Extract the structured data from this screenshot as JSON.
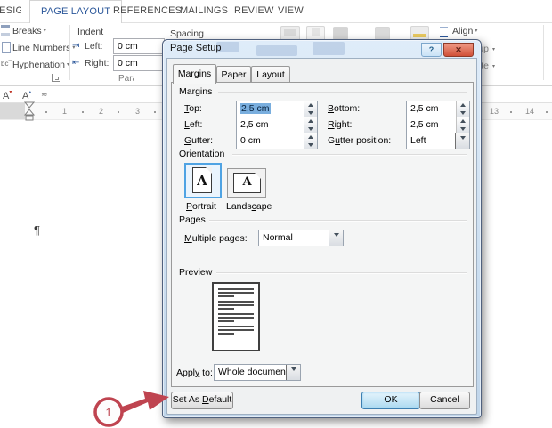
{
  "icons": {
    "caret": "▾",
    "help": "?",
    "close": "✕"
  },
  "ribbon": {
    "tabs": [
      {
        "label": "DESIGN",
        "active": false
      },
      {
        "label": "PAGE LAYOUT",
        "active": true
      },
      {
        "label": "REFERENCES",
        "active": false
      },
      {
        "label": "MAILINGS",
        "active": false
      },
      {
        "label": "REVIEW",
        "active": false
      },
      {
        "label": "VIEW",
        "active": false
      }
    ],
    "page_setup_group": {
      "breaks": "Breaks",
      "line_numbers": "Line Numbers",
      "hyphenation": "Hyphenation"
    },
    "paragraph_group": {
      "name": "Paragraph",
      "indent_title": "Indent",
      "left_label": "Left:",
      "left_value": "0 cm",
      "right_label": "Right:",
      "right_value": "0 cm",
      "spacing_title": "Spacing"
    },
    "arrange_group": {
      "align": "Align",
      "group": "Group",
      "rotate": "Rotate"
    }
  },
  "document": {
    "pilcrow": "¶",
    "ruler_left": [
      "1",
      "2",
      "3"
    ],
    "ruler_right": [
      "13",
      "14"
    ]
  },
  "dialog": {
    "title": "Page Setup",
    "tabs": [
      {
        "label": "Margins",
        "active": true
      },
      {
        "label": "Paper",
        "active": false
      },
      {
        "label": "Layout",
        "active": false
      }
    ],
    "margins": {
      "title": "Margins",
      "top_label": "&Top:",
      "top_value": "2,5 cm",
      "bottom_label": "&Bottom:",
      "bottom_value": "2,5 cm",
      "left_label": "&Left:",
      "left_value": "2,5 cm",
      "right_label": "&Right:",
      "right_value": "2,5 cm",
      "gutter_label": "&Gutter:",
      "gutter_value": "0 cm",
      "gutter_position_label": "G&utter position:",
      "gutter_position_value": "Left"
    },
    "orientation": {
      "title": "Orientation",
      "portrait_label": "&Portrait",
      "landscape_label": "Lands&cape",
      "page_letter": "A"
    },
    "pages": {
      "title": "Pages",
      "multiple_pages_label": "&Multiple pages:",
      "multiple_pages_value": "Normal"
    },
    "preview": {
      "title": "Preview"
    },
    "apply": {
      "label": "Appl&y to:",
      "value": "Whole document"
    },
    "buttons": {
      "set_as_default": "Set As &Default",
      "ok": "OK",
      "cancel": "Cancel"
    }
  },
  "annotation": {
    "number": "1"
  },
  "colors": {
    "accent_blue": "#2b579a",
    "annotation_red": "#bf4450",
    "selection_blue": "#79aede",
    "dialog_frame": "#bfd5ea"
  }
}
